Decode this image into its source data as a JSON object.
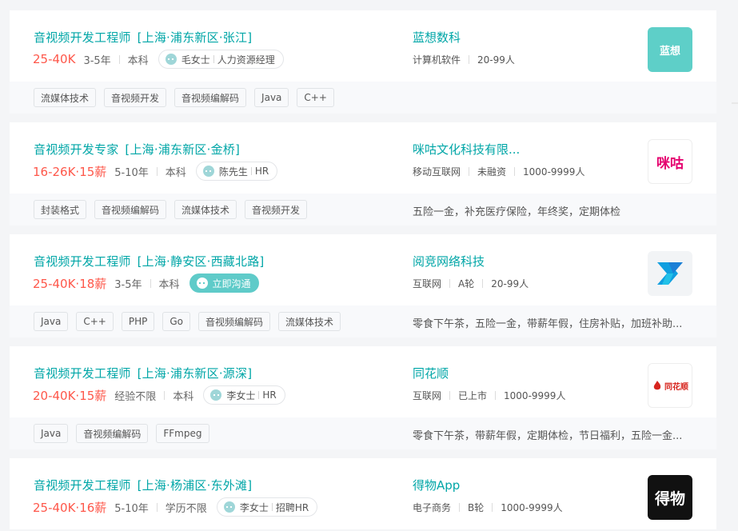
{
  "jobs": [
    {
      "title": "音视频开发工程师",
      "area": "[上海·浦东新区·张江]",
      "salary": "25-40K",
      "experience": "3-5年",
      "degree": "本科",
      "recruiter_name": "毛女士",
      "recruiter_role": "人力资源经理",
      "company": "蓝想数科",
      "company_info": [
        "计算机软件",
        "20-99人"
      ],
      "logo_text": "蓝想",
      "tags": [
        "流媒体技术",
        "音视频开发",
        "音视频编解码",
        "Java",
        "C++"
      ],
      "benefits": ""
    },
    {
      "title": "音视频开发专家",
      "area": "[上海·浦东新区·金桥]",
      "salary": "16-26K·15薪",
      "experience": "5-10年",
      "degree": "本科",
      "recruiter_name": "陈先生",
      "recruiter_role": "HR",
      "company": "咪咕文化科技有限...",
      "company_info": [
        "移动互联网",
        "未融资",
        "1000-9999人"
      ],
      "logo_text": "咪咕",
      "tags": [
        "封装格式",
        "音视频编解码",
        "流媒体技术",
        "音视频开发"
      ],
      "benefits": "五险一金，补充医疗保险，年终奖，定期体检"
    },
    {
      "title": "音视频开发工程师",
      "area": "[上海·静安区·西藏北路]",
      "salary": "25-40K·18薪",
      "experience": "3-5年",
      "degree": "本科",
      "chat_label": "立即沟通",
      "company": "阅竞网络科技",
      "company_info": [
        "互联网",
        "A轮",
        "20-99人"
      ],
      "tags": [
        "Java",
        "C++",
        "PHP",
        "Go",
        "音视频编解码",
        "流媒体技术"
      ],
      "benefits": "零食下午茶，五险一金，带薪年假，住房补贴，加班补助..."
    },
    {
      "title": "音视频开发工程师",
      "area": "[上海·浦东新区·源深]",
      "salary": "20-40K·15薪",
      "experience": "经验不限",
      "degree": "本科",
      "recruiter_name": "李女士",
      "recruiter_role": "HR",
      "company": "同花顺",
      "company_info": [
        "互联网",
        "已上市",
        "1000-9999人"
      ],
      "logo_text": "同花顺",
      "tags": [
        "Java",
        "音视频编解码",
        "FFmpeg"
      ],
      "benefits": "零食下午茶，带薪年假，定期体检，节日福利，五险一金..."
    },
    {
      "title": "音视频开发工程师",
      "area": "[上海·杨浦区·东外滩]",
      "salary": "25-40K·16薪",
      "experience": "5-10年",
      "degree": "学历不限",
      "recruiter_name": "李女士",
      "recruiter_role": "招聘HR",
      "company": "得物App",
      "company_info": [
        "电子商务",
        "B轮",
        "1000-9999人"
      ],
      "logo_text": "得物"
    }
  ],
  "colors": {
    "teal": "#00a6a7",
    "salary": "#fe574a",
    "chat_button": "#5fcbc9"
  }
}
